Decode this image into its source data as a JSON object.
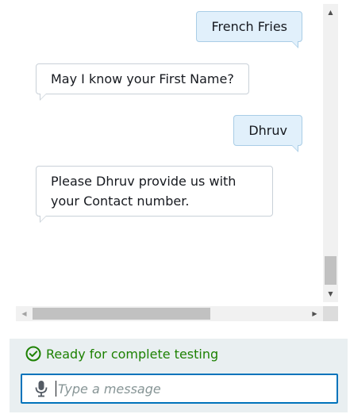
{
  "chat": {
    "messages": [
      {
        "sender": "user",
        "text": "French Fries"
      },
      {
        "sender": "bot",
        "text": "May I know your First Name?"
      },
      {
        "sender": "user",
        "text": "Dhruv"
      },
      {
        "sender": "bot",
        "text": "Please Dhruv provide us with your Contact number."
      }
    ]
  },
  "status": {
    "text": "Ready for complete testing",
    "icon": "check-circle-icon",
    "color": "#1d8102"
  },
  "input": {
    "placeholder": "Type a message",
    "value": "",
    "mic_icon": "microphone-icon"
  },
  "colors": {
    "accent": "#0073bb",
    "user_bubble": "#e1f0fb",
    "footer_bg": "#e9eff1"
  }
}
